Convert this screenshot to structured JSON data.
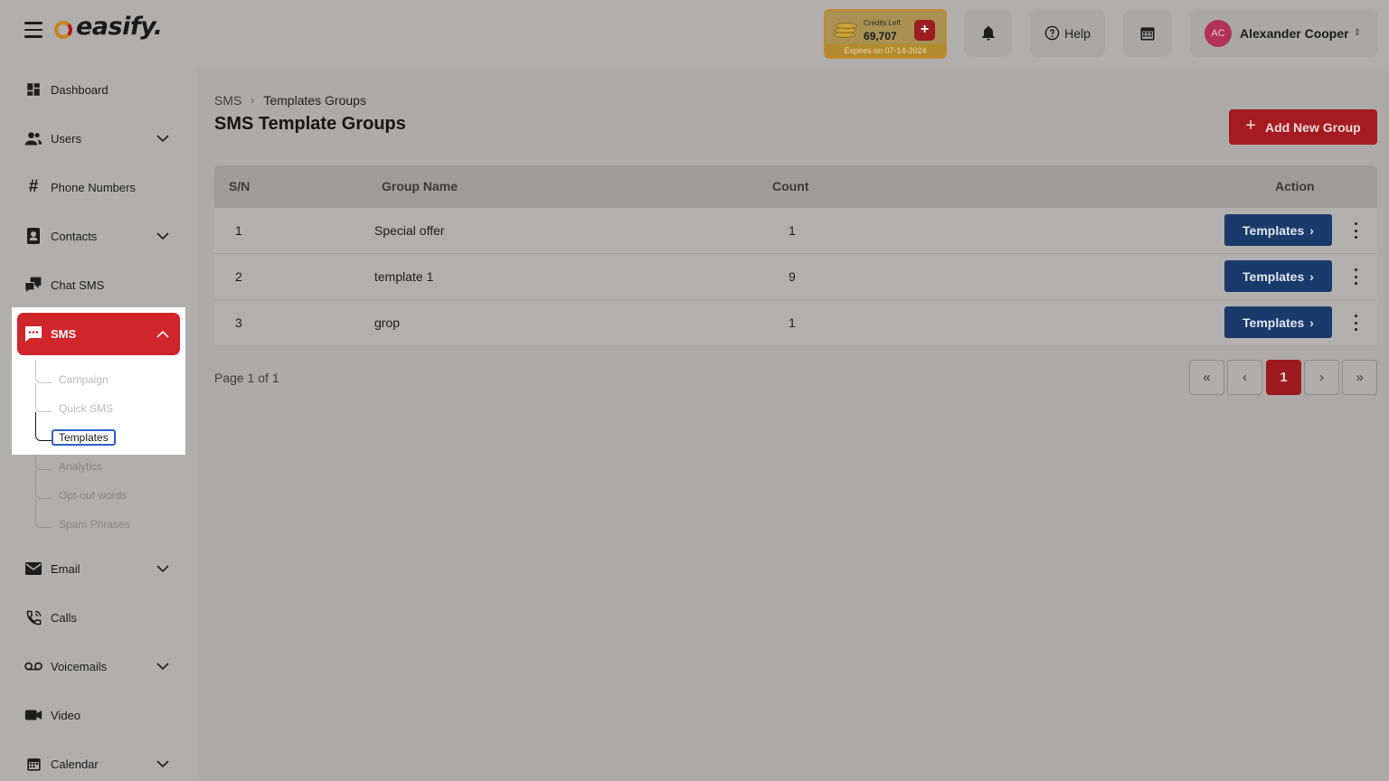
{
  "app": {
    "logo_text": "easify."
  },
  "header": {
    "credits_label": "Credits Left",
    "credits_amount": "69,707",
    "credits_add": "+",
    "credits_expiry": "Expires on 07-14-2024",
    "help_label": "Help",
    "user_initials": "AC",
    "user_name": "Alexander Cooper"
  },
  "sidebar": {
    "items": [
      {
        "label": "Dashboard",
        "icon": "dashboard-icon"
      },
      {
        "label": "Users",
        "icon": "users-icon"
      },
      {
        "label": "Phone Numbers",
        "icon": "hash-icon"
      },
      {
        "label": "Contacts",
        "icon": "contacts-icon"
      },
      {
        "label": "Chat SMS",
        "icon": "chat-icon"
      },
      {
        "label": "SMS",
        "icon": "sms-icon"
      },
      {
        "label": "Email",
        "icon": "mail-icon"
      },
      {
        "label": "Calls",
        "icon": "phone-icon"
      },
      {
        "label": "Voicemails",
        "icon": "voicemail-icon"
      },
      {
        "label": "Video",
        "icon": "video-icon"
      },
      {
        "label": "Calendar",
        "icon": "calendar-icon"
      }
    ],
    "sms_sub": [
      "Campaign",
      "Quick SMS",
      "Templates",
      "Analytics",
      "Opt-out words",
      "Spam Phrases"
    ]
  },
  "main": {
    "breadcrumb": [
      "SMS",
      "Templates Groups"
    ],
    "title": "SMS Template Groups",
    "add_button": "Add New Group",
    "columns": [
      "S/N",
      "Group Name",
      "Count",
      "Action"
    ],
    "rows": [
      {
        "sn": "1",
        "name": "Special offer",
        "count": "1",
        "action": "Templates"
      },
      {
        "sn": "2",
        "name": "template 1",
        "count": "9",
        "action": "Templates"
      },
      {
        "sn": "3",
        "name": "grop",
        "count": "1",
        "action": "Templates"
      }
    ],
    "page_info": "Page 1 of 1",
    "pager": {
      "first": "«",
      "prev": "‹",
      "current": "1",
      "next": "›",
      "last": "»"
    }
  },
  "colors": {
    "brand_red": "#d0252b",
    "action_blue": "#1a3a6b",
    "overlay_gray": "#b0afae"
  }
}
